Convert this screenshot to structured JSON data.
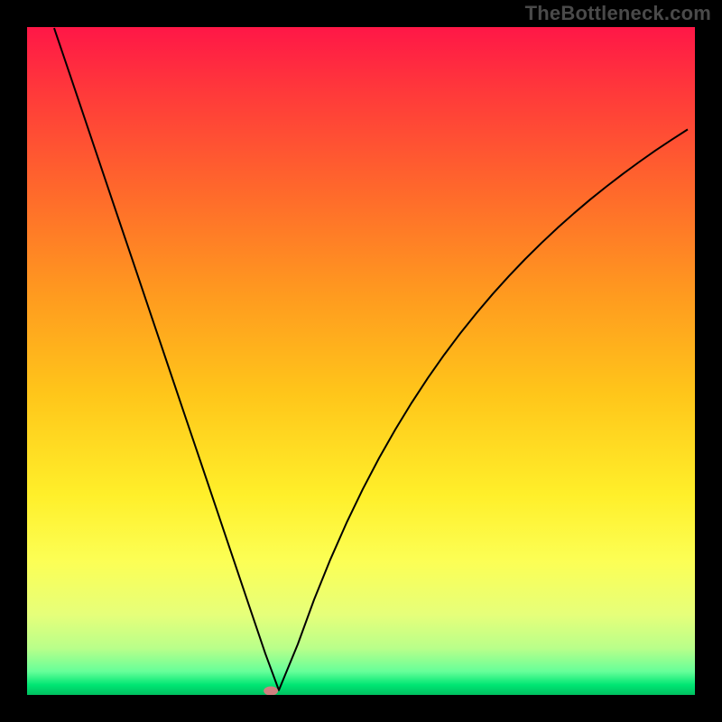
{
  "watermark": "TheBottleneck.com",
  "chart_data": {
    "type": "line",
    "title": "",
    "xlabel": "",
    "ylabel": "",
    "xlim": [
      0,
      100
    ],
    "ylim": [
      0,
      100
    ],
    "grid": false,
    "legend": false,
    "series": [
      {
        "name": "bottleneck-curve",
        "color": "#000000",
        "x": [
          4.05,
          6.49,
          8.92,
          11.35,
          13.78,
          16.22,
          18.65,
          21.08,
          23.51,
          25.95,
          28.38,
          30.81,
          33.24,
          35.68,
          37.7,
          40.54,
          42.97,
          45.41,
          47.84,
          50.27,
          52.7,
          55.14,
          57.57,
          60.0,
          62.43,
          64.86,
          67.3,
          69.73,
          72.16,
          74.59,
          77.03,
          79.46,
          81.89,
          84.32,
          86.76,
          89.19,
          91.62,
          94.05,
          96.49,
          98.92
        ],
        "values": [
          99.86,
          92.66,
          85.45,
          78.24,
          71.03,
          63.83,
          56.62,
          49.41,
          42.2,
          35.0,
          27.79,
          20.58,
          13.37,
          6.17,
          0.71,
          7.6,
          14.26,
          20.28,
          25.78,
          30.82,
          35.46,
          39.75,
          43.73,
          47.44,
          50.9,
          54.14,
          57.18,
          60.04,
          62.73,
          65.27,
          67.68,
          69.96,
          72.12,
          74.18,
          76.13,
          78.0,
          79.78,
          81.49,
          83.12,
          84.68
        ]
      }
    ],
    "marker": {
      "x": 36.5,
      "y": 0.6,
      "color": "#d08080"
    },
    "background_gradient": {
      "stops": [
        {
          "offset": 0.0,
          "color": "#ff1747"
        },
        {
          "offset": 0.1,
          "color": "#ff3a3a"
        },
        {
          "offset": 0.25,
          "color": "#ff6a2b"
        },
        {
          "offset": 0.4,
          "color": "#ff9a1f"
        },
        {
          "offset": 0.55,
          "color": "#ffc61a"
        },
        {
          "offset": 0.7,
          "color": "#ffef2a"
        },
        {
          "offset": 0.8,
          "color": "#fcff55"
        },
        {
          "offset": 0.88,
          "color": "#e6ff7a"
        },
        {
          "offset": 0.93,
          "color": "#b9ff8a"
        },
        {
          "offset": 0.965,
          "color": "#66ff99"
        },
        {
          "offset": 0.985,
          "color": "#00e673"
        },
        {
          "offset": 1.0,
          "color": "#00c060"
        }
      ]
    }
  }
}
